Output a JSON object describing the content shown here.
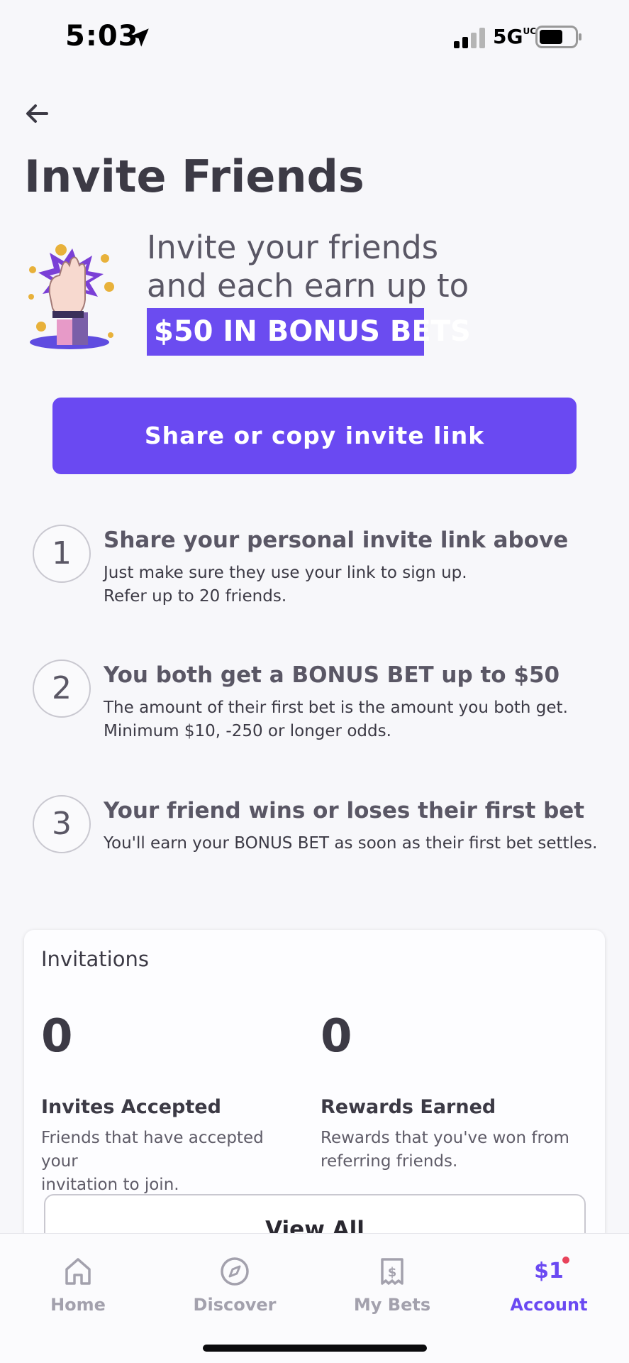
{
  "status_bar": {
    "time": "5:03",
    "network": "5G",
    "network_suffix": "UC"
  },
  "header": {
    "back_icon": "arrow-left-icon",
    "title": "Invite Friends"
  },
  "hero": {
    "line1": "Invite your friends",
    "line2": "and each earn up to",
    "highlight": "$50 IN BONUS BETS",
    "highlight_color": "#6b4cf0"
  },
  "share_button": {
    "label": "Share or copy invite link",
    "color": "#6a49f2"
  },
  "steps": [
    {
      "number": "1",
      "title": "Share your personal invite link above",
      "desc_lines": [
        "Just make sure they use your link to sign up.",
        "Refer up to 20 friends."
      ]
    },
    {
      "number": "2",
      "title": "You both get a BONUS BET up to $50",
      "desc_lines": [
        "The amount of their first bet is the amount you both get.",
        "Minimum $10, -250 or longer odds."
      ]
    },
    {
      "number": "3",
      "title": "Your friend wins or loses their first bet",
      "desc_lines": [
        "You'll earn your BONUS BET as soon as their first bet settles."
      ]
    }
  ],
  "invitations": {
    "title": "Invitations",
    "accepted": {
      "value": "0",
      "label": "Invites Accepted",
      "desc_lines": [
        "Friends that have accepted your",
        "invitation to join."
      ]
    },
    "rewards": {
      "value": "0",
      "label": "Rewards Earned",
      "desc_lines": [
        "Rewards that you've won from",
        "referring friends."
      ]
    },
    "view_all_label": "View All"
  },
  "tab_bar": {
    "items": [
      {
        "label": "Home",
        "icon": "home-icon"
      },
      {
        "label": "Discover",
        "icon": "compass-icon"
      },
      {
        "label": "My Bets",
        "icon": "bet-slip-icon"
      },
      {
        "label": "Account",
        "icon": "account-icon",
        "icon_text": "$1",
        "active": true
      }
    ],
    "active_color": "#6a49f2"
  }
}
